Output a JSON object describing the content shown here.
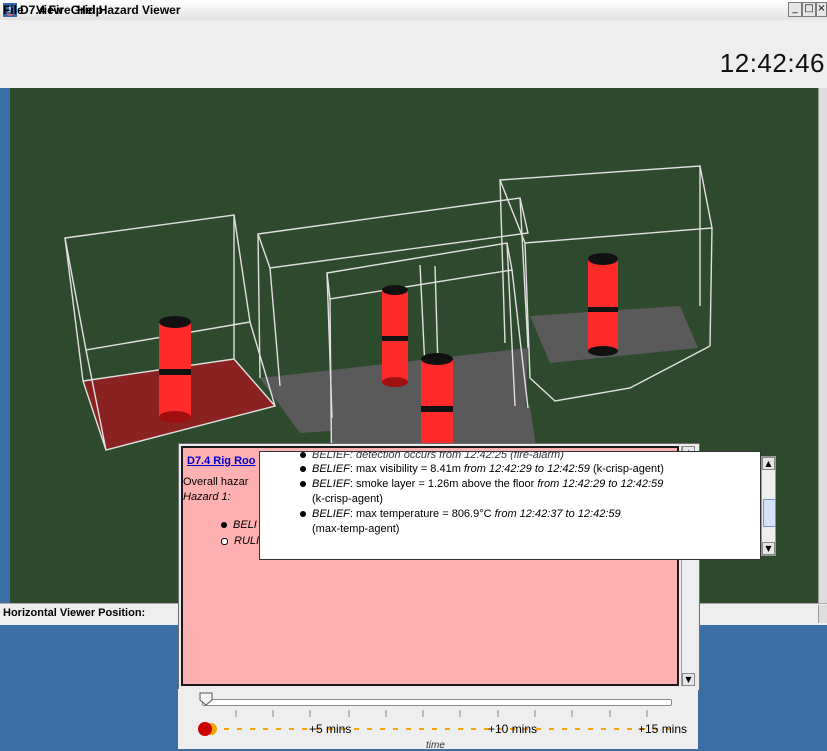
{
  "window": {
    "title": "D7.4 FireGrid Hazard Viewer",
    "minimize": "_",
    "maximize": "□",
    "close": "×"
  },
  "menu": [
    "File",
    "View",
    "Help"
  ],
  "clock": "12:42:46",
  "viewer": {
    "background": "#2e4a2c",
    "accent_red": "#ff2a2a",
    "floor_red": "#8a2222",
    "floor_gray": "#5a5a5a"
  },
  "horizontal_label": "Horizontal Viewer Position:",
  "panel": {
    "link": "D7.4 Rig Roo",
    "overall": "Overall hazar",
    "hazard": "Hazard 1:",
    "bullet1": "BELI",
    "bullet2": "RULI"
  },
  "tooltip": {
    "clipped_top": "BELIEF: detection occurs from 12:42:25 (fire-alarm)",
    "items": [
      {
        "belief": "BELIEF",
        "text": ": max visibility = 8.41m ",
        "from": "from 12:42:29 to 12:42:59",
        "agent": "(k-crisp-agent)"
      },
      {
        "belief": "BELIEF",
        "text": ": smoke layer = 1.26m above the floor ",
        "from": "from 12:42:29 to 12:42:59",
        "agent": "(k-crisp-agent)"
      },
      {
        "belief": "BELIEF",
        "text": ": max temperature = 806.9°C ",
        "from": "from 12:42:37 to 12:42:59",
        "agent": "(max-temp-agent)"
      }
    ]
  },
  "timeline": {
    "labels": [
      "+5 mins",
      "+10 mins",
      "+15 mins"
    ],
    "axis": "time"
  }
}
